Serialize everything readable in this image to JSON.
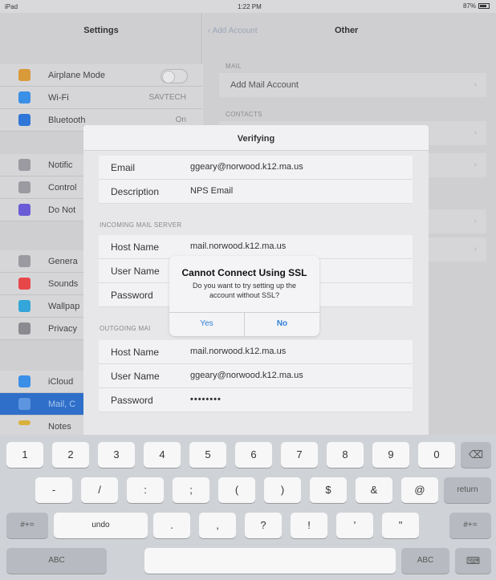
{
  "status": {
    "device": "iPad",
    "time": "1:22 PM",
    "battery": "87%"
  },
  "sidebar": {
    "title": "Settings",
    "items": [
      {
        "label": "Airplane Mode",
        "icon": "airplane-icon",
        "color": "#f0a030"
      },
      {
        "label": "Wi-Fi",
        "value": "SAVTECH",
        "icon": "wifi-icon",
        "color": "#3b8fe6"
      },
      {
        "label": "Bluetooth",
        "value": "On",
        "icon": "bluetooth-icon",
        "color": "#2f76d9"
      },
      {
        "label": "Notific",
        "icon": "notifications-icon",
        "color": "#9a9aa0"
      },
      {
        "label": "Control",
        "icon": "control-center-icon",
        "color": "#9a9aa0"
      },
      {
        "label": "Do Not",
        "icon": "moon-icon",
        "color": "#6b5bd6"
      },
      {
        "label": "Genera",
        "icon": "gear-icon",
        "color": "#9a9aa0"
      },
      {
        "label": "Sounds",
        "icon": "speaker-icon",
        "color": "#e8474a"
      },
      {
        "label": "Wallpap",
        "icon": "wallpaper-icon",
        "color": "#34a6d9"
      },
      {
        "label": "Privacy",
        "icon": "hand-icon",
        "color": "#8a8a90"
      },
      {
        "label": "iCloud",
        "icon": "cloud-icon",
        "color": "#3b8fe6"
      },
      {
        "label": "Mail, C",
        "icon": "mail-icon",
        "color": "#3b8fe6"
      },
      {
        "label": "Notes",
        "icon": "notes-icon",
        "color": "#f5c531"
      }
    ]
  },
  "main": {
    "back_label": "Add Account",
    "title": "Other",
    "sections": [
      {
        "header": "MAIL",
        "rows": [
          "Add Mail Account"
        ]
      },
      {
        "header": "CONTACTS",
        "rows": []
      }
    ]
  },
  "sheet": {
    "title": "Verifying",
    "top_fields": [
      {
        "label": "Email",
        "value": "ggeary@norwood.k12.ma.us"
      },
      {
        "label": "Description",
        "value": "NPS Email"
      }
    ],
    "incoming_header": "INCOMING MAIL SERVER",
    "incoming_fields": [
      {
        "label": "Host Name",
        "value": "mail.norwood.k12.ma.us"
      },
      {
        "label": "User Name",
        "value": ""
      },
      {
        "label": "Password",
        "value": ""
      }
    ],
    "outgoing_header": "OUTGOING MAI",
    "outgoing_fields": [
      {
        "label": "Host Name",
        "value": "mail.norwood.k12.ma.us"
      },
      {
        "label": "User Name",
        "value": "ggeary@norwood.k12.ma.us"
      },
      {
        "label": "Password",
        "value": "••••••••"
      }
    ]
  },
  "alert": {
    "title": "Cannot Connect Using SSL",
    "message": "Do you want to try setting up the account without SSL?",
    "yes": "Yes",
    "no": "No",
    "accent": "#2f7fd8"
  },
  "keyboard": {
    "row1": [
      "1",
      "2",
      "3",
      "4",
      "5",
      "6",
      "7",
      "8",
      "9",
      "0"
    ],
    "row2": [
      "-",
      "/",
      ":",
      ";",
      "(",
      ")",
      "$",
      "&",
      "@"
    ],
    "row3": [
      ".",
      ",",
      "?",
      "!",
      "'",
      "\""
    ],
    "return": "return",
    "undo": "undo",
    "switch": "#+=",
    "abc": "ABC"
  }
}
